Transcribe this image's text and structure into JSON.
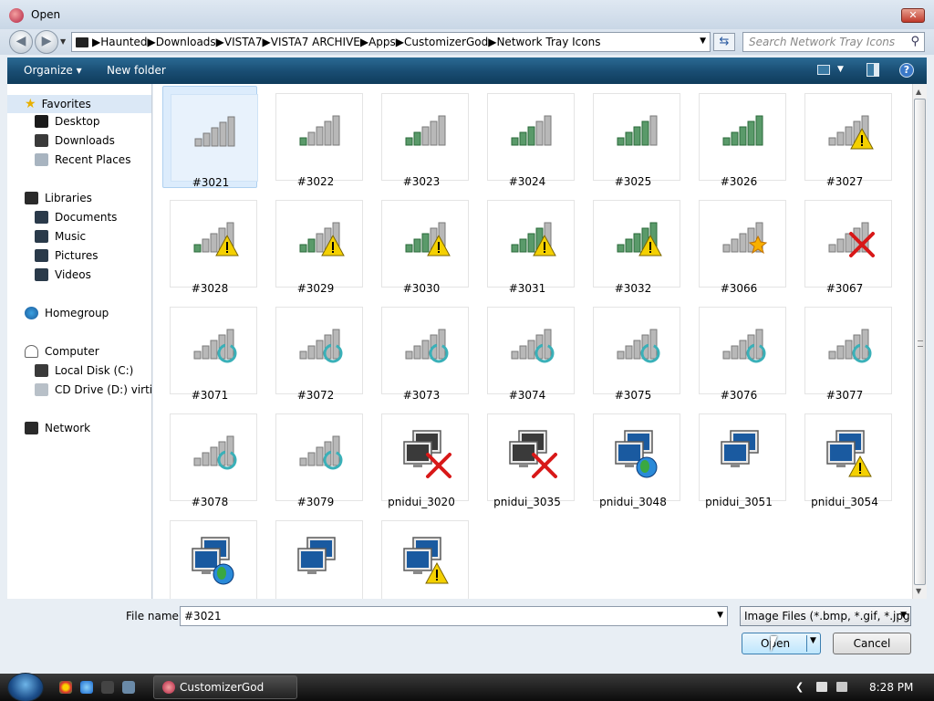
{
  "window": {
    "title": "Open"
  },
  "address": {
    "crumbs": [
      "Haunted",
      "Downloads",
      "VISTA7",
      "VISTA7 ARCHIVE",
      "Apps",
      "CustomizerGod",
      "Network Tray Icons"
    ]
  },
  "search": {
    "placeholder": "Search Network Tray Icons"
  },
  "toolbar": {
    "organize": "Organize ▾",
    "new_folder": "New folder"
  },
  "sidebar": {
    "favorites": "Favorites",
    "favorites_items": [
      "Desktop",
      "Downloads",
      "Recent Places"
    ],
    "libraries": "Libraries",
    "libraries_items": [
      "Documents",
      "Music",
      "Pictures",
      "Videos"
    ],
    "homegroup": "Homegroup",
    "computer": "Computer",
    "computer_items": [
      "Local Disk (C:)",
      "CD Drive (D:) virtio-win"
    ],
    "network": "Network"
  },
  "files": [
    {
      "name": "#3021",
      "kind": "signal",
      "bars": 0,
      "overlay": "none",
      "selected": true
    },
    {
      "name": "#3022",
      "kind": "signal",
      "bars": 1,
      "overlay": "none"
    },
    {
      "name": "#3023",
      "kind": "signal",
      "bars": 2,
      "overlay": "none"
    },
    {
      "name": "#3024",
      "kind": "signal",
      "bars": 3,
      "overlay": "none"
    },
    {
      "name": "#3025",
      "kind": "signal",
      "bars": 4,
      "overlay": "none"
    },
    {
      "name": "#3026",
      "kind": "signal",
      "bars": 5,
      "overlay": "none"
    },
    {
      "name": "#3027",
      "kind": "signal",
      "bars": 0,
      "overlay": "warning"
    },
    {
      "name": "#3028",
      "kind": "signal",
      "bars": 1,
      "overlay": "warning"
    },
    {
      "name": "#3029",
      "kind": "signal",
      "bars": 2,
      "overlay": "warning"
    },
    {
      "name": "#3030",
      "kind": "signal",
      "bars": 3,
      "overlay": "warning"
    },
    {
      "name": "#3031",
      "kind": "signal",
      "bars": 4,
      "overlay": "warning"
    },
    {
      "name": "#3032",
      "kind": "signal",
      "bars": 5,
      "overlay": "warning"
    },
    {
      "name": "#3066",
      "kind": "signal",
      "bars": 0,
      "overlay": "star"
    },
    {
      "name": "#3067",
      "kind": "signal",
      "bars": 0,
      "overlay": "x"
    },
    {
      "name": "#3071",
      "kind": "signal",
      "bars": 0,
      "overlay": "ring"
    },
    {
      "name": "#3072",
      "kind": "signal",
      "bars": 0,
      "overlay": "ring"
    },
    {
      "name": "#3073",
      "kind": "signal",
      "bars": 0,
      "overlay": "ring"
    },
    {
      "name": "#3074",
      "kind": "signal",
      "bars": 0,
      "overlay": "ring"
    },
    {
      "name": "#3075",
      "kind": "signal",
      "bars": 0,
      "overlay": "ring"
    },
    {
      "name": "#3076",
      "kind": "signal",
      "bars": 0,
      "overlay": "ring"
    },
    {
      "name": "#3077",
      "kind": "signal",
      "bars": 0,
      "overlay": "ring"
    },
    {
      "name": "#3078",
      "kind": "signal",
      "bars": 0,
      "overlay": "ring"
    },
    {
      "name": "#3079",
      "kind": "signal",
      "bars": 0,
      "overlay": "ring"
    },
    {
      "name": "pnidui_3020",
      "kind": "monitors",
      "screen": "dark",
      "overlay": "x"
    },
    {
      "name": "pnidui_3035",
      "kind": "monitors",
      "screen": "dark",
      "overlay": "x"
    },
    {
      "name": "pnidui_3048",
      "kind": "monitors",
      "screen": "blue",
      "overlay": "globe"
    },
    {
      "name": "pnidui_3051",
      "kind": "monitors",
      "screen": "blue",
      "overlay": "none"
    },
    {
      "name": "pnidui_3054",
      "kind": "monitors",
      "screen": "blue",
      "overlay": "warning"
    },
    {
      "name": "",
      "kind": "monitors",
      "screen": "blue",
      "overlay": "globe"
    },
    {
      "name": "",
      "kind": "monitors",
      "screen": "blue",
      "overlay": "none"
    },
    {
      "name": "",
      "kind": "monitors",
      "screen": "blue",
      "overlay": "warning"
    }
  ],
  "footer": {
    "file_name_label": "File name:",
    "file_name_value": "#3021",
    "file_type": "Image Files (*.bmp, *.gif, *.jpg,",
    "open_label": "Open",
    "cancel_label": "Cancel"
  },
  "taskbar": {
    "active_app": "CustomizerGod",
    "clock": "8:28 PM"
  },
  "colors": {
    "toolbar": "#1a4e74",
    "selection": "#dcecfc",
    "signal_green": "#5a9a6a",
    "warning_yellow": "#f4d000",
    "error_red": "#d81818"
  }
}
